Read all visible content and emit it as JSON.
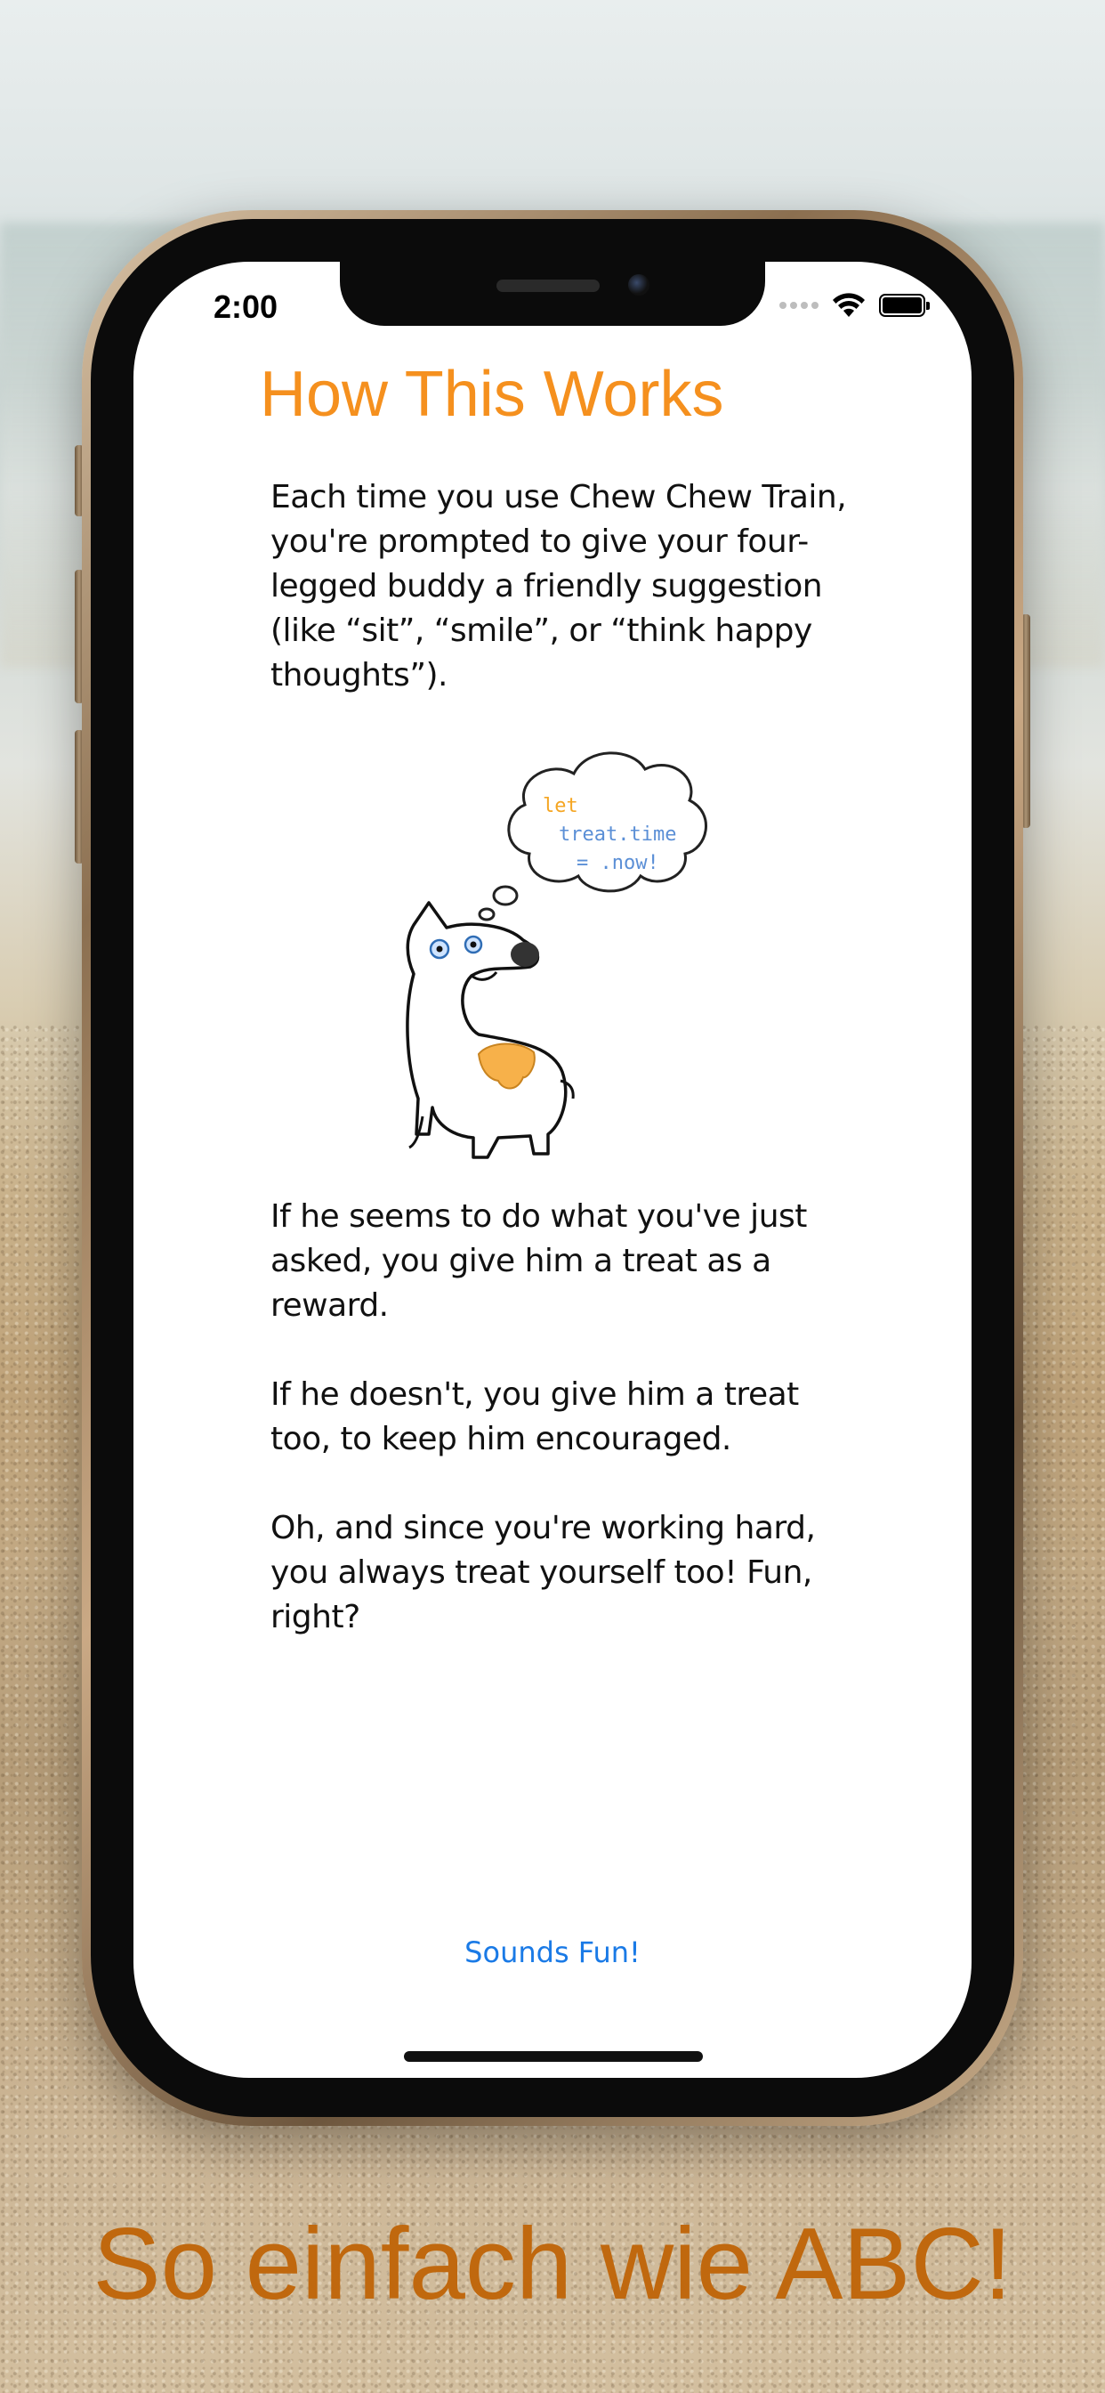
{
  "status_bar": {
    "time": "2:00"
  },
  "screen": {
    "title": "How This Works",
    "intro": "Each time you use Chew Chew Train, you're prompted  to give your four-legged buddy a friendly suggestion (like “sit”, “smile”, or “think happy thoughts”).",
    "thought_bubble": {
      "line1": "let",
      "line2": "treat.time",
      "line3": "= .now!"
    },
    "paragraph_2": "If he seems to do what you've just asked, you give him a treat as a reward.",
    "paragraph_3": "If he doesn't, you give him a treat too, to keep him encouraged.",
    "paragraph_4": "Oh, and since you're working hard, you always treat yourself too! Fun, right?",
    "cta_label": "Sounds Fun!"
  },
  "tagline": "So einfach wie ABC!",
  "colors": {
    "title": "#f5901e",
    "cta": "#1a7ae6",
    "tagline": "#c0680e",
    "code_keyword": "#f5a623",
    "code_text": "#5b8fd6"
  },
  "icons": [
    "wifi-icon",
    "battery-icon",
    "cellular-signal-icon",
    "dog-illustration"
  ]
}
